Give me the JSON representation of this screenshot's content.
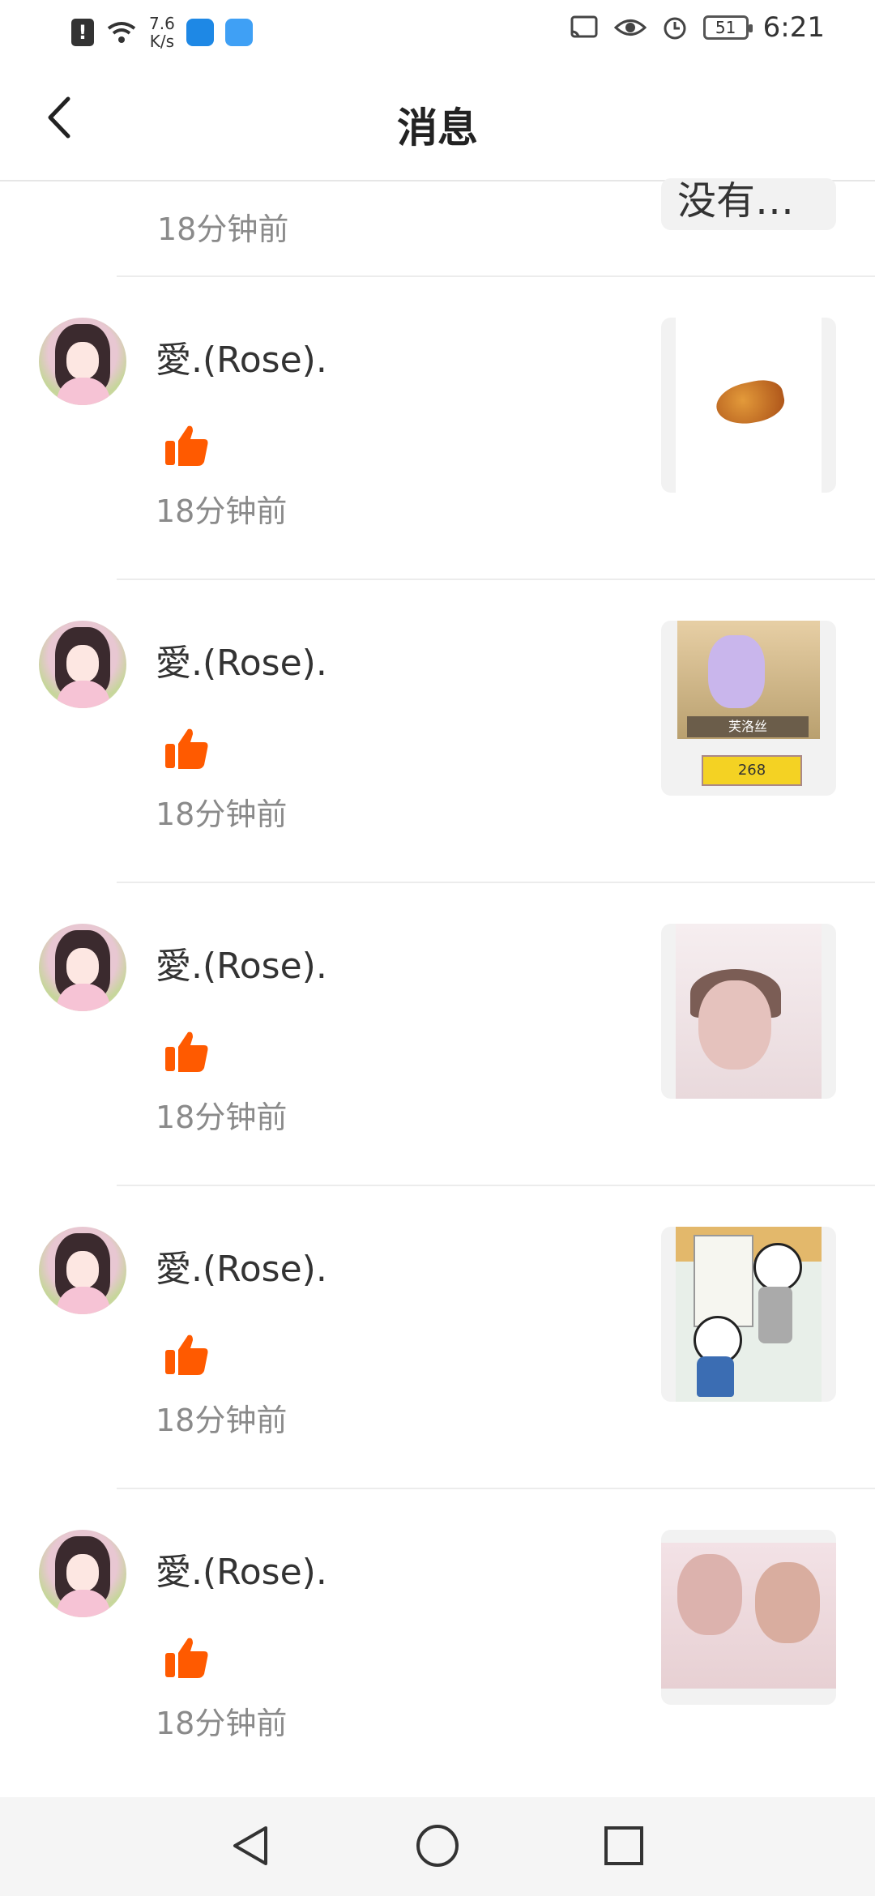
{
  "status_bar": {
    "speed_value": "7.6",
    "speed_unit": "K/s",
    "battery": "51",
    "time": "6:21",
    "icons": [
      "alert-icon",
      "wifi-icon",
      "weather-app-icon",
      "cloud-app-icon",
      "cast-icon",
      "eye-icon",
      "alarm-icon",
      "battery-icon"
    ]
  },
  "header": {
    "title": "消息",
    "back_icon": "chevron-left-icon"
  },
  "partial_item": {
    "time": "18分钟前",
    "thumb_text": "没有…"
  },
  "items": [
    {
      "name": "愛.(Rose).",
      "time": "18分钟前",
      "thumb": "chicken-leg-image"
    },
    {
      "name": "愛.(Rose).",
      "time": "18分钟前",
      "thumb": "game-character-image",
      "thumb_label": "芙洛丝",
      "thumb_price": "268"
    },
    {
      "name": "愛.(Rose).",
      "time": "18分钟前",
      "thumb": "selfie-image"
    },
    {
      "name": "愛.(Rose).",
      "time": "18分钟前",
      "thumb": "panda-meme-image"
    },
    {
      "name": "愛.(Rose).",
      "time": "18分钟前",
      "thumb": "couple-selfie-image"
    }
  ],
  "colors": {
    "like": "#FF5A00",
    "time_text": "#8A8A8A",
    "divider": "#ECECEC"
  },
  "navbar": {
    "icons": [
      "back-triangle-icon",
      "home-circle-icon",
      "recents-square-icon"
    ]
  }
}
